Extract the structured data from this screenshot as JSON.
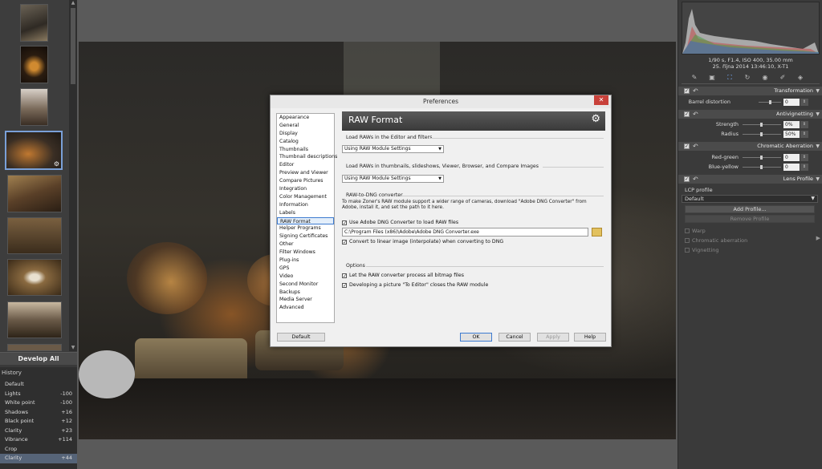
{
  "filmstrip": {
    "develop_all_label": "Develop All",
    "thumbs": 9
  },
  "history": {
    "title": "History",
    "items": [
      {
        "label": "Default",
        "value": ""
      },
      {
        "label": "Lights",
        "value": "-100"
      },
      {
        "label": "White point",
        "value": "-100"
      },
      {
        "label": "Shadows",
        "value": "+16"
      },
      {
        "label": "Black point",
        "value": "+12"
      },
      {
        "label": "Clarity",
        "value": "+23"
      },
      {
        "label": "Vibrance",
        "value": "+114"
      },
      {
        "label": "Crop",
        "value": ""
      },
      {
        "label": "Clarity",
        "value": "+44"
      }
    ],
    "selected_index": 8
  },
  "right_panel": {
    "exif_line1": "1/90 s, F1.4, ISO 400, 35.00 mm",
    "exif_line2": "25. října 2014 13:46:10, X-T1",
    "transformation": {
      "title": "Transformation",
      "barrel_label": "Barrel distortion",
      "barrel_value": "0"
    },
    "antivignetting": {
      "title": "Antivignetting",
      "strength_label": "Strength",
      "strength_value": "0%",
      "radius_label": "Radius",
      "radius_value": "50%"
    },
    "chromatic": {
      "title": "Chromatic Aberration",
      "red_label": "Red-green",
      "red_value": "0",
      "blue_label": "Blue-yellow",
      "blue_value": "0"
    },
    "lens_profile": {
      "title": "Lens Profile",
      "lcp_label": "LCP profile",
      "lcp_value": "Default",
      "add_profile": "Add Profile...",
      "remove_profile": "Remove Profile",
      "warp": "Warp",
      "chromatic_aberration": "Chromatic aberration",
      "vignetting": "Vignetting"
    }
  },
  "dialog": {
    "title": "Preferences",
    "close_glyph": "✕",
    "nav_items": [
      "Appearance",
      "General",
      "Display",
      "Catalog",
      "Thumbnails",
      "Thumbnail descriptions",
      "Editor",
      "Preview and Viewer",
      "Compare Pictures",
      "Integration",
      "Color Management",
      "Information",
      "Labels",
      "RAW Format",
      "Helper Programs",
      "Signing Certificates",
      "Other",
      "Filter Windows",
      "Plug-ins",
      "GPS",
      "Video",
      "Second Monitor",
      "Backups",
      "Media Server",
      "Advanced"
    ],
    "selected_nav": 13,
    "header": "RAW Format",
    "group1_label": "Load RAWs in the Editor and filters",
    "select1_value": "Using RAW Module Settings",
    "group2_label": "Load RAWs in thumbnails, slideshows, Viewer, Browser, and Compare Images",
    "select2_value": "Using RAW Module Settings",
    "group3_label": "RAW-to-DNG converter",
    "dng_desc": "To make Zoner's RAW module support a wider range of cameras, download \"Adobe DNG Converter\" from Adobe, install it, and set the path to it here.",
    "use_dng_label": "Use Adobe DNG Converter to load RAW files",
    "dng_path": "C:\\Program Files (x86)\\Adobe\\Adobe DNG Converter.exe",
    "convert_linear_label": "Convert to linear image (interpolate) when converting to DNG",
    "group4_label": "Options",
    "opt1_label": "Let the RAW converter process all bitmap files",
    "opt2_label": "Developing a picture \"To Editor\" closes the RAW module",
    "buttons": {
      "default": "Default",
      "ok": "OK",
      "cancel": "Cancel",
      "apply": "Apply",
      "help": "Help"
    }
  },
  "colors": {
    "selection": "#566478",
    "dialog_accent": "#3d7bd0",
    "close_red": "#c8413a"
  }
}
